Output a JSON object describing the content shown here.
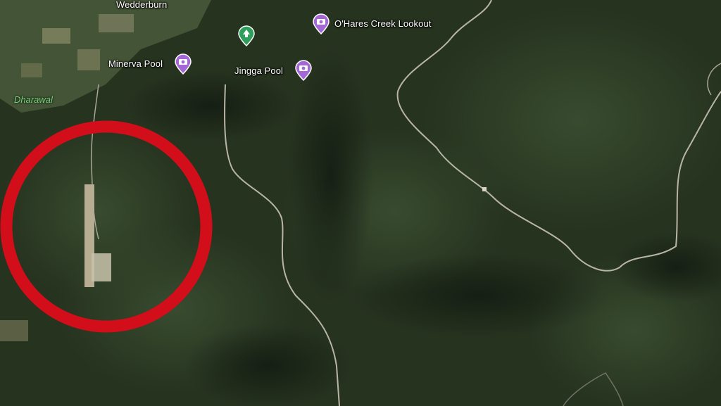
{
  "map": {
    "settlement_label": "Wedderburn",
    "area_label": "Dharawal",
    "colors": {
      "forest": "#24321f",
      "forest_light": "#34472c",
      "road": "#b9b5a6",
      "highlight_circle": "#d10e1a",
      "poi_purple": "#a367d6",
      "park_green": "#2e9e5b",
      "area_label": "#7fd27f"
    },
    "pois": [
      {
        "label": "O'Hares Creek Lookout",
        "icon": "camera-icon"
      },
      {
        "label": "Minerva Pool",
        "icon": "camera-icon"
      },
      {
        "label": "Jingga Pool",
        "icon": "camera-icon"
      },
      {
        "label": "",
        "icon": "park-tree-icon"
      }
    ],
    "annotation": {
      "shape": "circle",
      "description_shown": ""
    }
  }
}
